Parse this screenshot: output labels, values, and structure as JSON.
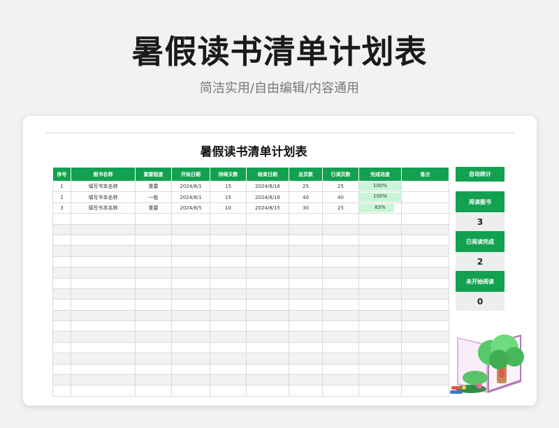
{
  "hero": {
    "title": "暑假读书清单计划表",
    "subtitle": "简洁实用/自由编辑/内容通用"
  },
  "sheet": {
    "title": "暑假读书清单计划表",
    "columns": [
      "序号",
      "图书名称",
      "重要程度",
      "开始日期",
      "持续天数",
      "结束日期",
      "总页数",
      "已读页数",
      "完成进度",
      "备注"
    ],
    "rows": [
      {
        "no": "1",
        "name": "填写书本名称",
        "importance": "重要",
        "start": "2024/8/1",
        "days": "15",
        "end": "2024/8/16",
        "total": "25",
        "read": "25",
        "progress": "100%",
        "progress_value": 1.0,
        "note": ""
      },
      {
        "no": "2",
        "name": "填写书本名称",
        "importance": "一般",
        "start": "2024/8/1",
        "days": "15",
        "end": "2024/8/16",
        "total": "40",
        "read": "40",
        "progress": "100%",
        "progress_value": 1.0,
        "note": ""
      },
      {
        "no": "3",
        "name": "填写书本名称",
        "importance": "重要",
        "start": "2024/8/5",
        "days": "10",
        "end": "2024/8/15",
        "total": "30",
        "read": "25",
        "progress": "83%",
        "progress_value": 0.83,
        "note": ""
      }
    ]
  },
  "stats": {
    "header": "自动统计",
    "items": [
      {
        "label": "阅读图书",
        "value": "3"
      },
      {
        "label": "已阅读完成",
        "value": "2"
      },
      {
        "label": "未开始阅读",
        "value": "0"
      }
    ]
  },
  "colors": {
    "accent": "#12a150",
    "progress_fill": "#c9f5d7",
    "stripe": "#f2f2f2"
  }
}
